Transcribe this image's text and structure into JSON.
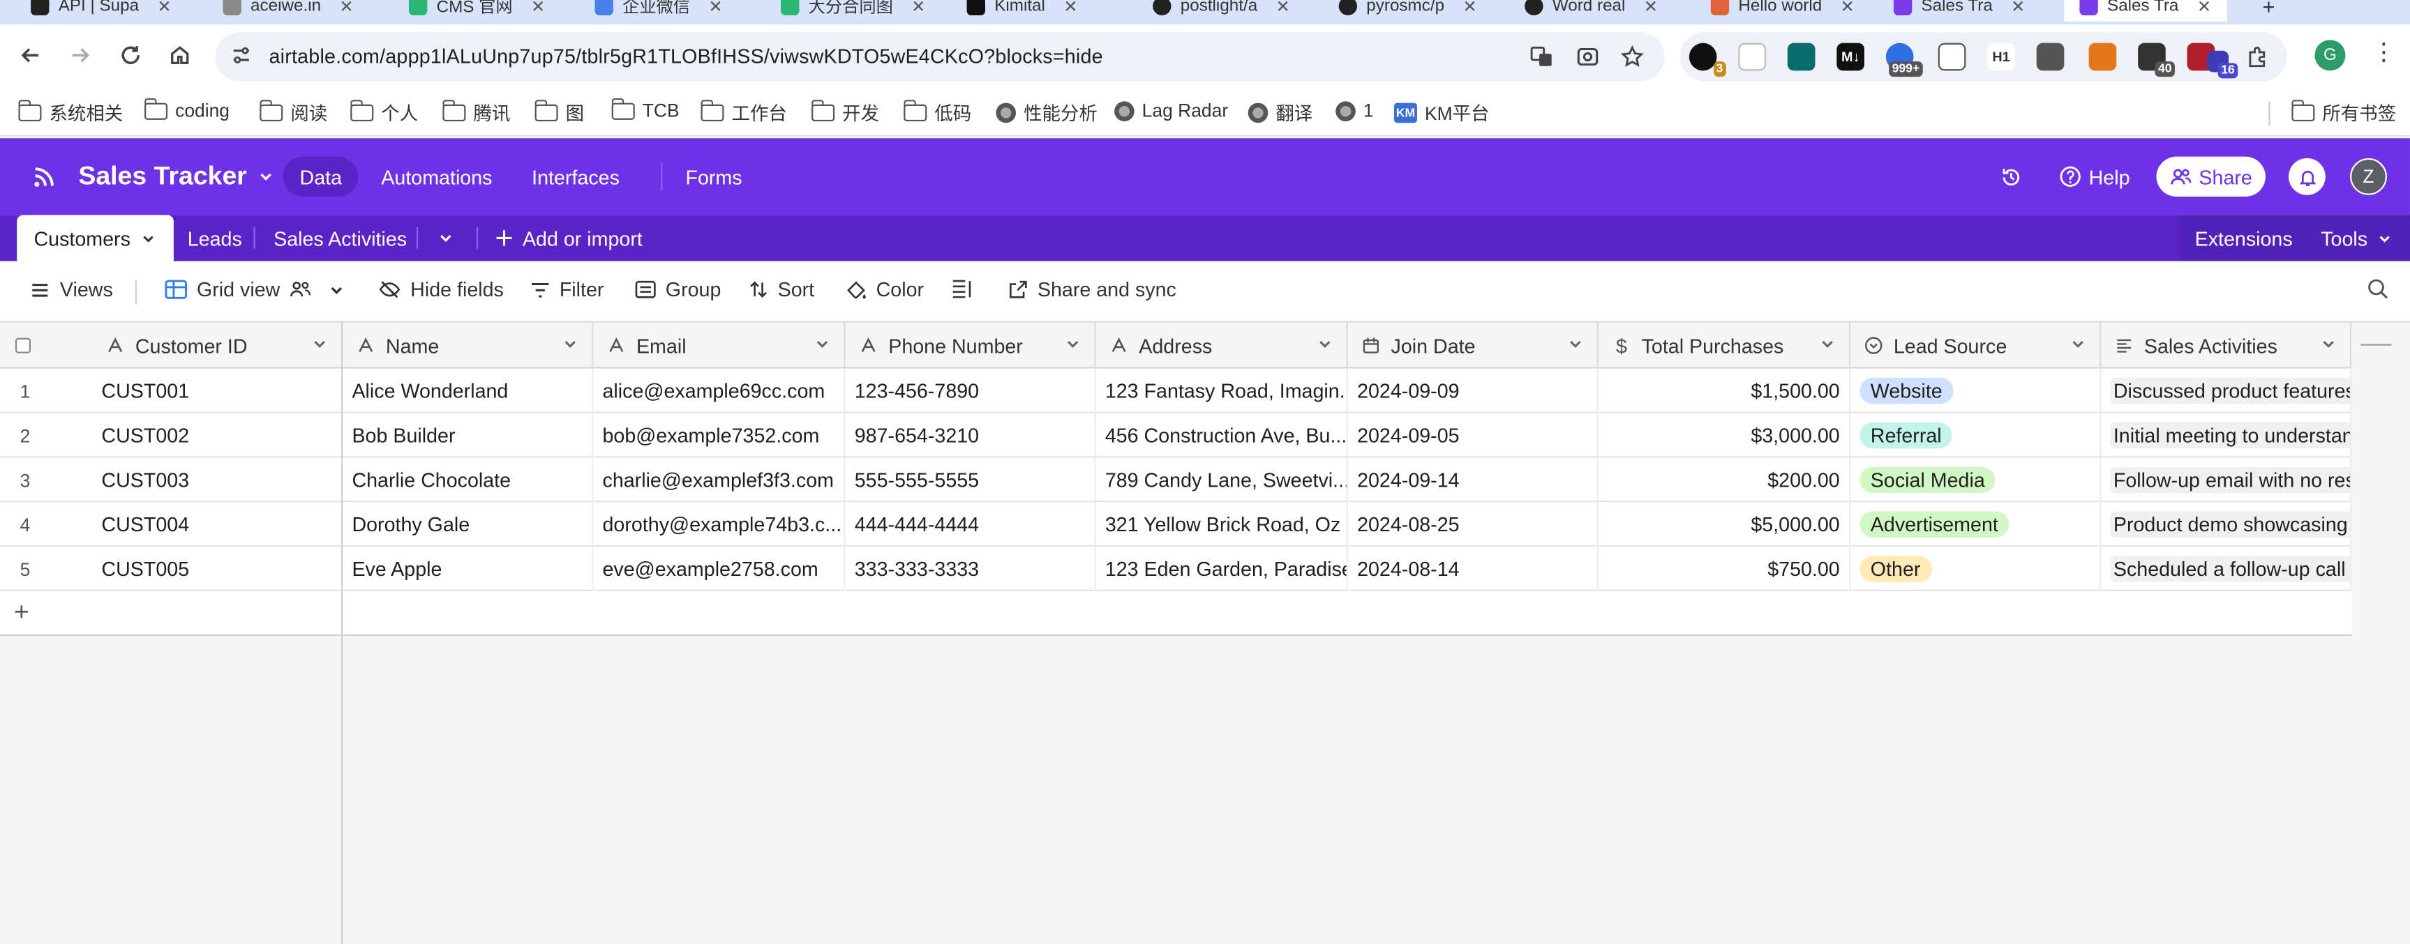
{
  "browser": {
    "tabs": [
      {
        "label": "API | Supa",
        "color": "#222"
      },
      {
        "label": "aceiwe.in",
        "color": "#888"
      },
      {
        "label": "CMS 官网",
        "color": "#2bb673"
      },
      {
        "label": "企业微信",
        "color": "#4a7ee8"
      },
      {
        "label": "大分合同图",
        "color": "#2bb673"
      },
      {
        "label": "Kimital",
        "color": "#111"
      },
      {
        "label": "postlight/a",
        "color": "#222"
      },
      {
        "label": "pyrosmc/p",
        "color": "#222"
      },
      {
        "label": "Word real",
        "color": "#222"
      },
      {
        "label": "Hello world",
        "color": "#e0623a"
      },
      {
        "label": "Sales Tra",
        "color": "#7a3bea"
      },
      {
        "label": "Sales Tra",
        "color": "#7a3bea"
      }
    ],
    "url": "airtable.com/appp1lALuUnp7up75/tblr5gR1TLOBfIHSS/viwswKDTO5wE4CKcO?blocks=hide",
    "extension_badges": {
      "e1": "3",
      "e2": "999+",
      "e3": "40",
      "e4": "16"
    },
    "extension_labels": {
      "m": "M↓",
      "h1": "H1"
    },
    "profile_initial": "G"
  },
  "bookmarks": [
    {
      "label": "系统相关",
      "icon": "folder"
    },
    {
      "label": "coding",
      "icon": "folder"
    },
    {
      "label": "阅读",
      "icon": "folder"
    },
    {
      "label": "个人",
      "icon": "folder"
    },
    {
      "label": "腾讯",
      "icon": "folder"
    },
    {
      "label": "图",
      "icon": "folder"
    },
    {
      "label": "TCB",
      "icon": "folder"
    },
    {
      "label": "工作台",
      "icon": "folder"
    },
    {
      "label": "开发",
      "icon": "folder"
    },
    {
      "label": "低码",
      "icon": "folder"
    },
    {
      "label": "性能分析",
      "icon": "globe"
    },
    {
      "label": "Lag Radar",
      "icon": "globe"
    },
    {
      "label": "翻译",
      "icon": "globe"
    },
    {
      "label": "1",
      "icon": "globe"
    },
    {
      "label": "KM平台",
      "icon": "km"
    }
  ],
  "bookmarks_right": "所有书签",
  "km_icon_text": "KM",
  "app": {
    "base_name": "Sales Tracker",
    "nav": [
      "Data",
      "Automations",
      "Interfaces",
      "Forms"
    ],
    "help": "Help",
    "share": "Share",
    "avatar_initial": "Z",
    "accent": "#6d32e8"
  },
  "tables": {
    "items": [
      "Customers",
      "Leads",
      "Sales Activities"
    ],
    "add": "Add or import",
    "extensions": "Extensions",
    "tools": "Tools"
  },
  "toolbar": {
    "views": "Views",
    "grid_view": "Grid view",
    "hide_fields": "Hide fields",
    "filter": "Filter",
    "group": "Group",
    "sort": "Sort",
    "color": "Color",
    "share_sync": "Share and sync"
  },
  "columns": [
    {
      "label": "Customer ID",
      "type": "text"
    },
    {
      "label": "Name",
      "type": "text"
    },
    {
      "label": "Email",
      "type": "text"
    },
    {
      "label": "Phone Number",
      "type": "text"
    },
    {
      "label": "Address",
      "type": "text"
    },
    {
      "label": "Join Date",
      "type": "date"
    },
    {
      "label": "Total Purchases",
      "type": "currency"
    },
    {
      "label": "Lead Source",
      "type": "select"
    },
    {
      "label": "Sales Activities",
      "type": "long-text"
    }
  ],
  "rows": [
    {
      "n": "1",
      "id": "CUST001",
      "name": "Alice Wonderland",
      "email": "alice@example69cc.com",
      "phone": "123-456-7890",
      "address": "123 Fantasy Road, Imagin...",
      "join": "2024-09-09",
      "total": "$1,500.00",
      "source": "Website",
      "source_color": "#cfdfff",
      "activity": "Discussed product features"
    },
    {
      "n": "2",
      "id": "CUST002",
      "name": "Bob Builder",
      "email": "bob@example7352.com",
      "phone": "987-654-3210",
      "address": "456 Construction Ave, Bu...",
      "join": "2024-09-05",
      "total": "$3,000.00",
      "source": "Referral",
      "source_color": "#c2f5e9",
      "activity": "Initial meeting to understan"
    },
    {
      "n": "3",
      "id": "CUST003",
      "name": "Charlie Chocolate",
      "email": "charlie@examplef3f3.com",
      "phone": "555-555-5555",
      "address": "789 Candy Lane, Sweetvi...",
      "join": "2024-09-14",
      "total": "$200.00",
      "source": "Social Media",
      "source_color": "#d1f7c4",
      "activity": "Follow-up email with no resp"
    },
    {
      "n": "4",
      "id": "CUST004",
      "name": "Dorothy Gale",
      "email": "dorothy@example74b3.c...",
      "phone": "444-444-4444",
      "address": "321 Yellow Brick Road, Oz",
      "join": "2024-08-25",
      "total": "$5,000.00",
      "source": "Advertisement",
      "source_color": "#d1f7c4",
      "activity": "Product demo showcasing k"
    },
    {
      "n": "5",
      "id": "CUST005",
      "name": "Eve Apple",
      "email": "eve@example2758.com",
      "phone": "333-333-3333",
      "address": "123 Eden Garden, Paradise",
      "join": "2024-08-14",
      "total": "$750.00",
      "source": "Other",
      "source_color": "#ffeab6",
      "activity": "Scheduled a follow-up call f"
    }
  ],
  "add_row_symbol": "+"
}
